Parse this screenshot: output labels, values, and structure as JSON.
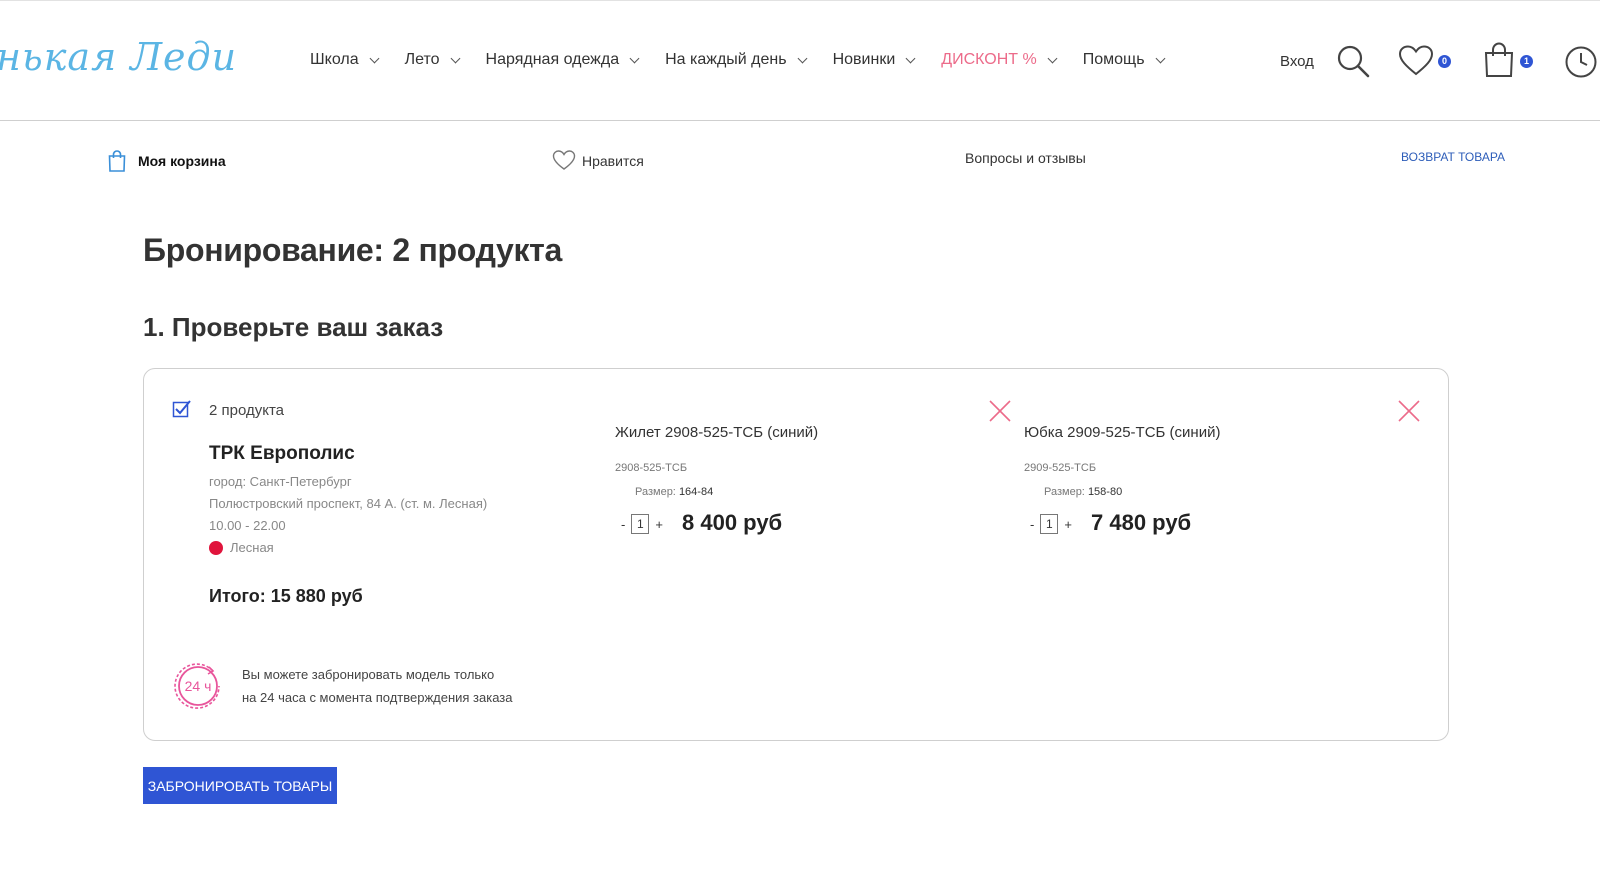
{
  "header": {
    "logo_text": "нькая Леди",
    "nav": [
      {
        "label": "Школа"
      },
      {
        "label": "Лето"
      },
      {
        "label": "Нарядная одежда"
      },
      {
        "label": "На каждый день"
      },
      {
        "label": "Новинки"
      },
      {
        "label": "ДИСКОНТ %"
      },
      {
        "label": "Помощь"
      }
    ],
    "login_label": "Вход",
    "wishlist_count": "0",
    "cart_count": "1"
  },
  "subnav": {
    "cart_label": "Моя корзина",
    "likes_label": "Нравится",
    "qa_label": "Вопросы и отзывы",
    "return_label": "ВОЗВРАТ ТОВАРА"
  },
  "page": {
    "title": "Бронирование: 2 продукта",
    "step_title": "1. Проверьте ваш заказ"
  },
  "order": {
    "count_label": "2 продукта",
    "store_name": "ТРК Европолис",
    "city": "город: Санкт-Петербург",
    "address": "Полюстровский проспект, 84 А. (ст. м. Лесная)",
    "hours": "10.00 - 22.00",
    "metro": "Лесная",
    "total": "Итого: 15 880 руб",
    "note_line1": "Вы можете забронировать модель только",
    "note_line2": "на 24 часа с момента подтверждения заказа",
    "note_icon_text": "24 ч"
  },
  "products": [
    {
      "name": "Жилет 2908-525-ТСБ (синий)",
      "sku": "2908-525-ТСБ",
      "size_label": "Размер:",
      "size": "164-84",
      "qty": "1",
      "price": "8 400 руб"
    },
    {
      "name": "Юбка 2909-525-ТСБ (синий)",
      "sku": "2909-525-ТСБ",
      "size_label": "Размер:",
      "size": "158-80",
      "qty": "1",
      "price": "7 480 руб"
    }
  ],
  "actions": {
    "book_label": "ЗАБРОНИРОВАТЬ ТОВАРЫ"
  },
  "colors": {
    "accent": "#2f55d4",
    "discount": "#ec6b8a",
    "metro": "#e0143c",
    "logo": "#5bb5e4",
    "remove": "#ec6b8a"
  },
  "icons": [
    "search-icon",
    "heart-icon",
    "bag-icon",
    "clock-icon",
    "checkbox-icon",
    "close-icon",
    "timer-24h-icon"
  ]
}
